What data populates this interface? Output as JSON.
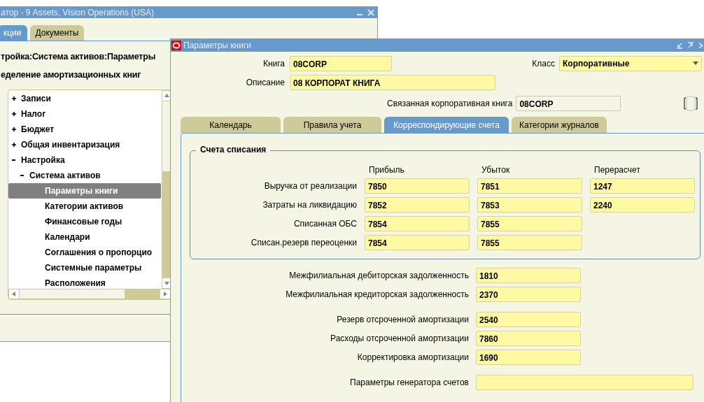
{
  "back_window": {
    "title": "атор - 9 Assets, Vision Operations (USA)",
    "tabs": [
      {
        "label": "кции",
        "selected": true
      },
      {
        "label": "Документы",
        "selected": false
      }
    ],
    "breadcrumb": "тройка:Система активов:Параметры",
    "heading": "еделение амортизационных книг",
    "tree": [
      {
        "label": "Записи",
        "expanded": false,
        "selected": false
      },
      {
        "label": "Налог",
        "expanded": false,
        "selected": false
      },
      {
        "label": "Бюджет",
        "expanded": false,
        "selected": false
      },
      {
        "label": "Общая инвентаризация",
        "expanded": false,
        "selected": false
      },
      {
        "label": "Настройка",
        "expanded": true,
        "selected": false,
        "children": [
          {
            "label": "Система активов",
            "expanded": true,
            "selected": false,
            "children": [
              {
                "label": "Параметры книги",
                "selected": true
              },
              {
                "label": "Категории активов",
                "selected": false
              },
              {
                "label": "Финансовые годы",
                "selected": false
              },
              {
                "label": "Календари",
                "selected": false
              },
              {
                "label": "Соглашения о пропорцио",
                "selected": false
              },
              {
                "label": "Системные параметры",
                "selected": false
              },
              {
                "label": "Расположения",
                "selected": false
              }
            ]
          }
        ]
      }
    ]
  },
  "front_window": {
    "title": "Параметры книги",
    "book": {
      "label": "Книга",
      "value": "08CORP"
    },
    "class": {
      "label": "Класс",
      "value": "Корпоративные"
    },
    "description": {
      "label": "Описание",
      "value": "08 КОРПОРАТ КНИГА"
    },
    "linked_book": {
      "label": "Связанная корпоративная книга",
      "value": "08CORP"
    },
    "checkbox": {
      "checked": false
    },
    "tabs": [
      {
        "label": "Календарь",
        "selected": false
      },
      {
        "label": "Правила учета",
        "selected": false
      },
      {
        "label": "Корреспондирующие счета",
        "selected": true
      },
      {
        "label": "Категории журналов",
        "selected": false
      }
    ],
    "write_off": {
      "title": "Счета списания",
      "columns": [
        "Прибыль",
        "Убыток",
        "Перерасчет"
      ],
      "rows": [
        {
          "label": "Выручка от реализации",
          "values": [
            "7850",
            "7851",
            "1247"
          ]
        },
        {
          "label": "Затраты на ликвидацию",
          "values": [
            "7852",
            "7853",
            "2240"
          ]
        },
        {
          "label": "Списанная ОБС",
          "values": [
            "7854",
            "7855"
          ]
        },
        {
          "label": "Списан.резерв переоценки",
          "values": [
            "7854",
            "7855"
          ]
        }
      ]
    },
    "account_groups": [
      [
        {
          "label": "Межфилиальная дебиторская задолженность",
          "value": "1810"
        },
        {
          "label": "Межфилиальная кредиторская задолженность",
          "value": "2370"
        }
      ],
      [
        {
          "label": "Резерв отсроченной амортизации",
          "value": "2540"
        },
        {
          "label": "Расходы отсроченной амортизации",
          "value": "7860"
        },
        {
          "label": "Корректировка амортизации",
          "value": "1690"
        }
      ],
      [
        {
          "label": "Параметры генератора счетов",
          "wide": true
        }
      ]
    ]
  }
}
